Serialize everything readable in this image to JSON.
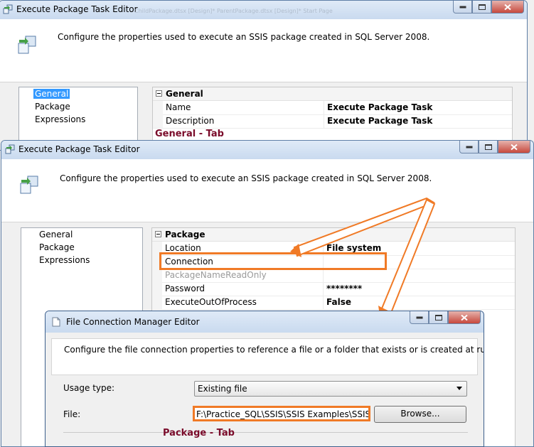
{
  "window1": {
    "title": "Execute Package Task Editor",
    "background_tabs": "ChildPackage.dtsx [Design]*   ParentPackage.dtsx [Design]*   Start Page",
    "description": "Configure the properties used to execute an SSIS package created in SQL Server 2008.",
    "nav_items": [
      "General",
      "Package",
      "Expressions"
    ],
    "selected_nav": "General",
    "category": "General",
    "properties": [
      {
        "name": "Name",
        "value": "Execute Package Task"
      },
      {
        "name": "Description",
        "value": "Execute Package Task"
      }
    ]
  },
  "window2": {
    "title": "Execute Package Task Editor",
    "description": "Configure the properties used to execute an SSIS package created in SQL Server 2008.",
    "nav_items": [
      "General",
      "Package",
      "Expressions"
    ],
    "category": "Package",
    "properties": [
      {
        "name": "Location",
        "value": "File system",
        "gray": false
      },
      {
        "name": "Connection",
        "value": "",
        "gray": false
      },
      {
        "name": "PackageNameReadOnly",
        "value": "",
        "gray": true
      },
      {
        "name": "Password",
        "value": "********",
        "gray": false
      },
      {
        "name": "ExecuteOutOfProcess",
        "value": "False",
        "gray": false
      }
    ]
  },
  "window3": {
    "title": "File Connection Manager Editor",
    "description": "Configure the file connection properties to reference a file or a folder that exists or is created at run time.",
    "usage_label": "Usage type:",
    "usage_value": "Existing file",
    "file_label": "File:",
    "file_value": "F:\\Practice_SQL\\SSIS\\SSIS Examples\\SSIS Exar",
    "browse_label": "Browse..."
  },
  "annotations": {
    "general_tab": "General - Tab",
    "package_tab": "Package - Tab"
  },
  "colors": {
    "highlight": "#f07a26",
    "annotation_text": "#7a0b2a"
  }
}
